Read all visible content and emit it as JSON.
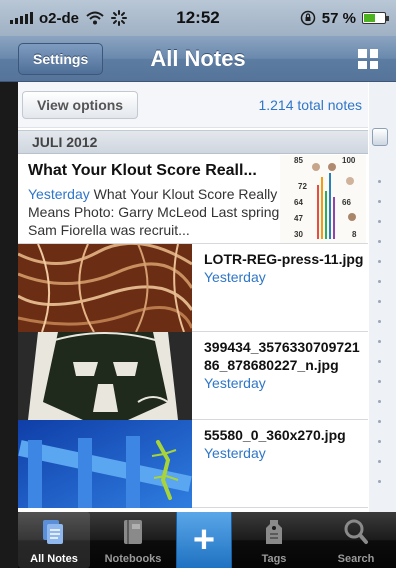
{
  "status_bar": {
    "carrier": "o2-de",
    "time": "12:52",
    "battery": "57 %",
    "battery_level": 0.57
  },
  "nav": {
    "settings_label": "Settings",
    "title": "All Notes",
    "grid_icon": "grid-icon"
  },
  "options": {
    "view_options_label": "View options",
    "total_notes": "1.214 total notes"
  },
  "section": {
    "label": "JULI 2012"
  },
  "notes": [
    {
      "title": "What Your Klout Score Reall...",
      "date": "Yesterday",
      "snippet": " What Your Klout Score Really Means Photo: Garry McLeod Last spring Sam Fiorella was recruit...",
      "infographic_numbers": [
        "85",
        "100",
        "72",
        "64",
        "66",
        "47",
        "30",
        "8"
      ]
    },
    {
      "title": "LOTR-REG-press-11.jpg",
      "date": "Yesterday"
    },
    {
      "title": "399434_357633070972186_878680227_n.jpg",
      "date": "Yesterday"
    },
    {
      "title": "55580_0_360x270.jpg",
      "date": "Yesterday"
    }
  ],
  "tabs": [
    {
      "label": "All Notes",
      "icon": "notes-stack-icon",
      "active": true
    },
    {
      "label": "Notebooks",
      "icon": "notebook-icon"
    },
    {
      "label": "",
      "icon": "plus-icon"
    },
    {
      "label": "Tags",
      "icon": "tag-icon"
    },
    {
      "label": "Search",
      "icon": "search-icon"
    }
  ],
  "colors": {
    "accent_blue": "#2f76c9",
    "nav_blue": "#6a89ad",
    "plus_blue": "#1f72c2"
  }
}
